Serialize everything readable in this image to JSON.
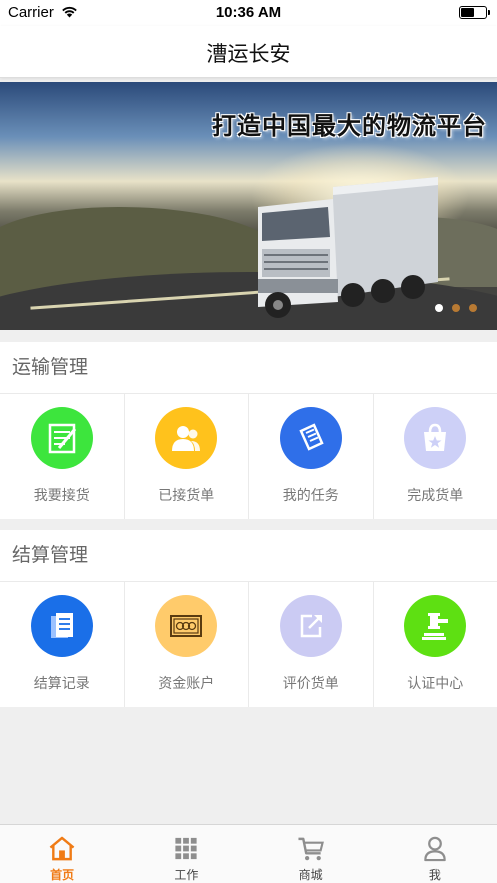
{
  "status_bar": {
    "carrier": "Carrier",
    "time": "10:36 AM"
  },
  "nav": {
    "title": "漕运长安"
  },
  "banner": {
    "slogan": "打造中国最大的物流平台",
    "slide_count": 3,
    "active_slide": 1
  },
  "sections": [
    {
      "title": "运输管理",
      "items": [
        {
          "label": "我要接货",
          "icon": "checklist-icon",
          "color": "#3de53d"
        },
        {
          "label": "已接货单",
          "icon": "users-icon",
          "color": "#ffc21c"
        },
        {
          "label": "我的任务",
          "icon": "scroll-icon",
          "color": "#2f6fe9"
        },
        {
          "label": "完成货单",
          "icon": "shopping-bag-icon",
          "color": "#cdd0f7"
        }
      ]
    },
    {
      "title": "结算管理",
      "items": [
        {
          "label": "结算记录",
          "icon": "documents-icon",
          "color": "#1a6fe8"
        },
        {
          "label": "资金账户",
          "icon": "money-icon",
          "color": "#ffcb6b"
        },
        {
          "label": "评价货单",
          "icon": "share-icon",
          "color": "#cbcbf3"
        },
        {
          "label": "认证中心",
          "icon": "gavel-icon",
          "color": "#5ee012"
        }
      ]
    }
  ],
  "tabs": [
    {
      "label": "首页",
      "icon": "home-icon",
      "active": true
    },
    {
      "label": "工作",
      "icon": "grid-icon",
      "active": false
    },
    {
      "label": "商城",
      "icon": "cart-icon",
      "active": false
    },
    {
      "label": "我",
      "icon": "person-icon",
      "active": false
    }
  ],
  "colors": {
    "accent": "#f07b15"
  }
}
